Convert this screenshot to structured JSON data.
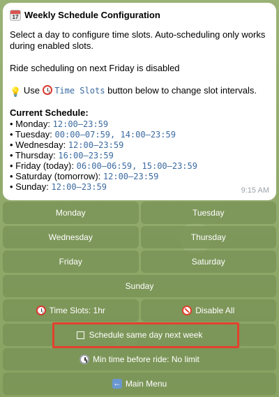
{
  "message": {
    "title": "Weekly Schedule Configuration",
    "intro": "Select a day to configure time slots. Auto-scheduling only works during enabled slots.",
    "status": "Ride scheduling on next Friday is disabled",
    "tip_prefix": "Use",
    "tip_code": "Time Slots",
    "tip_suffix": "button below to change slot intervals.",
    "schedule_title": "Current Schedule:",
    "schedule": [
      {
        "day": "• Monday:",
        "times": "12:00–23:59"
      },
      {
        "day": "• Tuesday:",
        "times": "00:00–07:59, 14:00–23:59"
      },
      {
        "day": "• Wednesday:",
        "times": "12:00–23:59"
      },
      {
        "day": "• Thursday:",
        "times": "16:00–23:59"
      },
      {
        "day": "• Friday (today):",
        "times": "06:00–06:59, 15:00–23:59"
      },
      {
        "day": "• Saturday (tomorrow):",
        "times": "12:00–23:59"
      },
      {
        "day": "• Sunday:",
        "times": "12:00–23:59"
      }
    ],
    "time": "9:15 AM"
  },
  "keyboard": {
    "monday": "Monday",
    "tuesday": "Tuesday",
    "wednesday": "Wednesday",
    "thursday": "Thursday",
    "friday": "Friday",
    "saturday": "Saturday",
    "sunday": "Sunday",
    "time_slots": "Time Slots: 1hr",
    "disable_all": "Disable All",
    "schedule_next_week": "Schedule same day next week",
    "min_time": "Min time before ride: No limit",
    "main_menu": "Main Menu"
  },
  "icons": {
    "title": "calendar-icon",
    "tip": "lightbulb-icon",
    "time_slots": "alarm-clock-icon",
    "disable": "no-entry-icon",
    "checkbox": "checkbox-icon",
    "min_time": "stopwatch-icon",
    "main_menu": "back-arrow-icon"
  },
  "colors": {
    "highlight": "#e2412e",
    "mono_text": "#3a6aa0",
    "button_bg": "#7a9256"
  }
}
